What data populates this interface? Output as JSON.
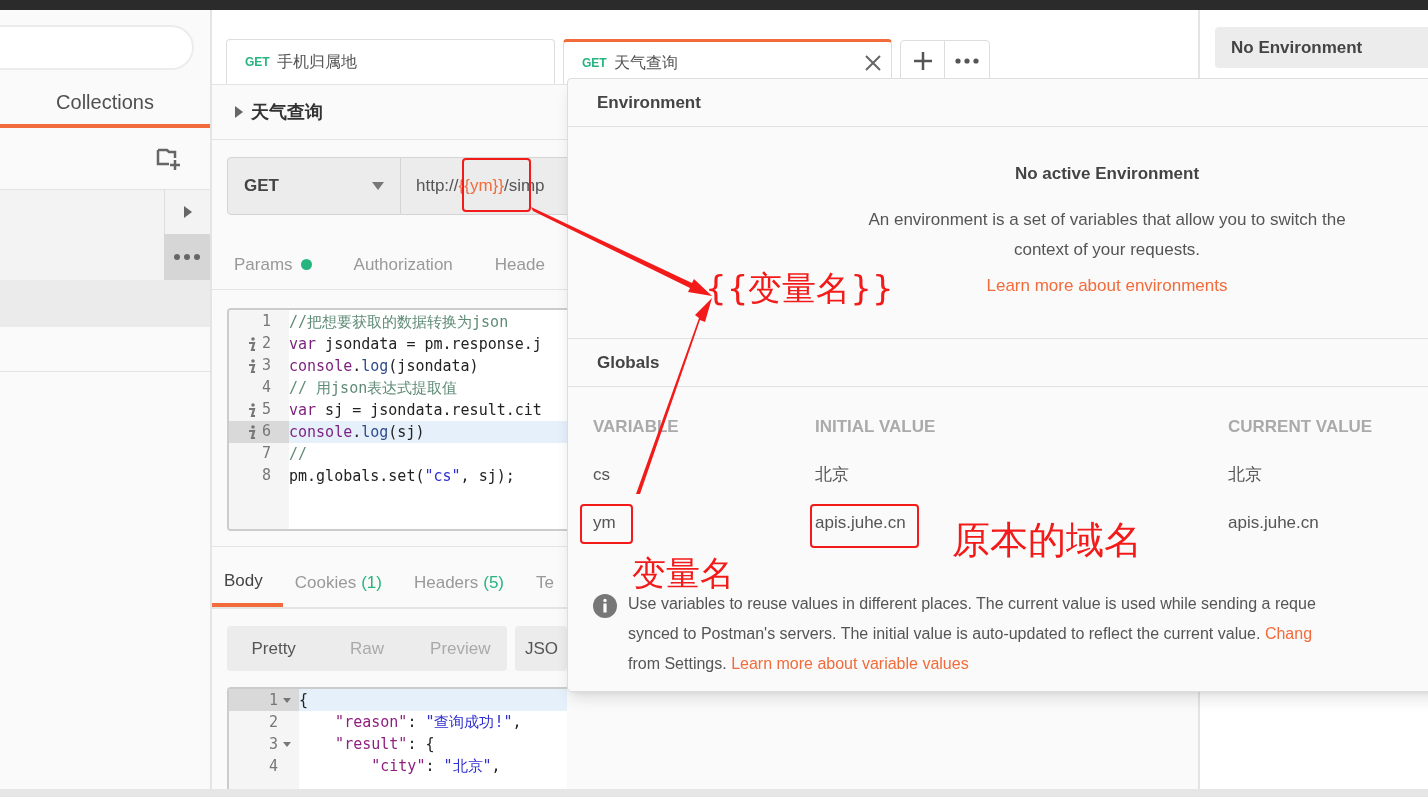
{
  "sidebar": {
    "tabs": [
      {
        "label": "Collections",
        "selected": true
      }
    ]
  },
  "request_tabs": [
    {
      "method": "GET",
      "title": "手机归属地",
      "selected": false
    },
    {
      "method": "GET",
      "title": "天气查询",
      "selected": true
    }
  ],
  "request": {
    "name": "天气查询",
    "method": "GET",
    "url_parts": [
      {
        "kind": "plain",
        "text": "http://"
      },
      {
        "kind": "variable",
        "text": "{{ym}}"
      },
      {
        "kind": "plain",
        "text": "/simp"
      }
    ],
    "tabs": [
      {
        "label": "Params",
        "selected": false,
        "has_data": true
      },
      {
        "label": "Authorization",
        "selected": false,
        "has_data": false
      },
      {
        "label": "Heade",
        "selected": false,
        "has_data": false
      }
    ]
  },
  "script": {
    "lines": [
      {
        "number": "1",
        "info": false,
        "highlighted": false,
        "tokens": [
          {
            "kind": "comment",
            "text": "//把想要获取的数据转换为json"
          }
        ]
      },
      {
        "number": "2",
        "info": true,
        "highlighted": false,
        "tokens": [
          {
            "kind": "keyword",
            "text": "var"
          },
          {
            "kind": "plain",
            "text": " jsondata = pm.response.j"
          }
        ]
      },
      {
        "number": "3",
        "info": true,
        "highlighted": false,
        "tokens": [
          {
            "kind": "keyword",
            "text": "console"
          },
          {
            "kind": "plain",
            "text": "."
          },
          {
            "kind": "method",
            "text": "log"
          },
          {
            "kind": "plain",
            "text": "(jsondata)"
          }
        ]
      },
      {
        "number": "4",
        "info": false,
        "highlighted": false,
        "tokens": [
          {
            "kind": "comment",
            "text": "// 用json表达式提取值"
          }
        ]
      },
      {
        "number": "5",
        "info": true,
        "highlighted": false,
        "tokens": [
          {
            "kind": "keyword",
            "text": "var"
          },
          {
            "kind": "plain",
            "text": " sj = jsondata.result.cit"
          }
        ]
      },
      {
        "number": "6",
        "info": true,
        "highlighted": true,
        "tokens": [
          {
            "kind": "keyword",
            "text": "console"
          },
          {
            "kind": "plain",
            "text": "."
          },
          {
            "kind": "method",
            "text": "log"
          },
          {
            "kind": "plain",
            "text": "(sj)"
          }
        ]
      },
      {
        "number": "7",
        "info": false,
        "highlighted": false,
        "tokens": [
          {
            "kind": "comment",
            "text": "//"
          }
        ]
      },
      {
        "number": "8",
        "info": false,
        "highlighted": false,
        "tokens": [
          {
            "kind": "plain",
            "text": "pm.globals.set("
          },
          {
            "kind": "string",
            "text": "\"cs\""
          },
          {
            "kind": "plain",
            "text": ", sj);"
          }
        ]
      }
    ]
  },
  "response": {
    "tabs": [
      {
        "label": "Body",
        "selected": true
      },
      {
        "label": "Cookies",
        "count": "(1)",
        "selected": false
      },
      {
        "label": "Headers",
        "count": "(5)",
        "selected": false
      },
      {
        "label": "Te",
        "selected": false
      }
    ],
    "formats": [
      {
        "label": "Pretty",
        "selected": true
      },
      {
        "label": "Raw",
        "selected": false
      },
      {
        "label": "Preview",
        "selected": false
      }
    ],
    "type_button": "JSO",
    "lines": [
      {
        "number": "1",
        "fold": true,
        "highlighted": true,
        "tokens": [
          {
            "kind": "plain",
            "text": "{"
          }
        ]
      },
      {
        "number": "2",
        "fold": false,
        "highlighted": false,
        "tokens": [
          {
            "kind": "key",
            "text": "    \"reason\""
          },
          {
            "kind": "plain",
            "text": ": "
          },
          {
            "kind": "string",
            "text": "\"查询成功!\""
          },
          {
            "kind": "plain",
            "text": ","
          }
        ]
      },
      {
        "number": "3",
        "fold": true,
        "highlighted": false,
        "tokens": [
          {
            "kind": "key",
            "text": "    \"result\""
          },
          {
            "kind": "plain",
            "text": ": {"
          }
        ]
      },
      {
        "number": "4",
        "fold": false,
        "highlighted": false,
        "tokens": [
          {
            "kind": "key",
            "text": "        \"city\""
          },
          {
            "kind": "plain",
            "text": ": "
          },
          {
            "kind": "string",
            "text": "\"北京\""
          },
          {
            "kind": "plain",
            "text": ","
          }
        ]
      }
    ]
  },
  "environment_select": {
    "value": "No Environment"
  },
  "environment_popover": {
    "title": "Environment",
    "empty_title": "No active Environment",
    "empty_text": "An environment is a set of variables that allow you to switch the context of your requests.",
    "empty_link": "Learn more about environments",
    "globals_title": "Globals",
    "columns": [
      "VARIABLE",
      "INITIAL VALUE",
      "CURRENT VALUE"
    ],
    "rows": [
      [
        "cs",
        "北京",
        "北京"
      ],
      [
        "ym",
        "apis.juhe.cn",
        "apis.juhe.cn"
      ]
    ],
    "note_lines": [
      {
        "text": "Use variables to reuse values in different places. The current value is used while sending a reque"
      },
      {
        "text": "synced to Postman's servers. The initial value is auto-updated to reflect the current value. ",
        "link": "Chang"
      },
      {
        "text": "from Settings. ",
        "link": "Learn more about variable values"
      }
    ]
  },
  "annotations": [
    {
      "kind": "variable_syntax",
      "text": "{{变量名}}"
    },
    {
      "kind": "variable_name",
      "text": "变量名"
    },
    {
      "kind": "original_domain",
      "text": "原本的域名"
    }
  ]
}
